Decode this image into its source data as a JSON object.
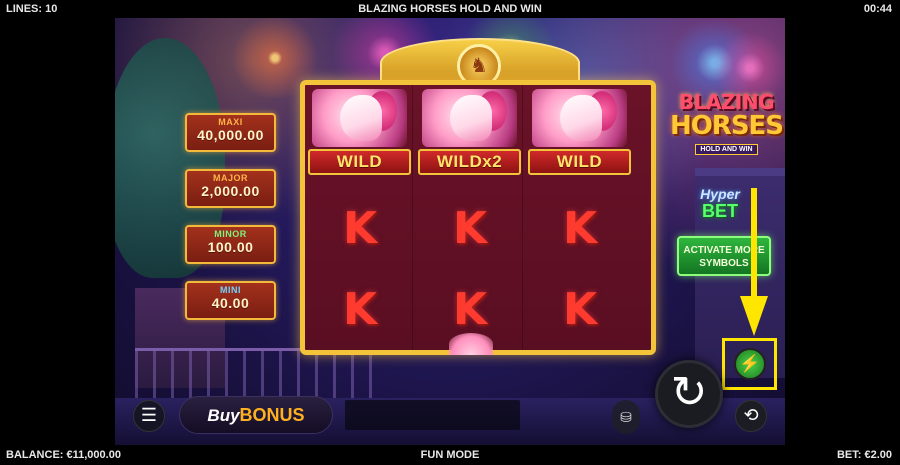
{
  "topbar": {
    "lines": "LINES: 10",
    "title": "BLAZING HORSES HOLD AND WIN",
    "clock": "00:44"
  },
  "bottombar": {
    "balance": "BALANCE: €11,000.00",
    "mode": "FUN MODE",
    "bet": "BET: €2.00"
  },
  "jackpots": [
    {
      "label": "MAXI",
      "value": "40,000.00",
      "color": "#ffb347"
    },
    {
      "label": "MAJOR",
      "value": "2,000.00",
      "color": "#ffb347"
    },
    {
      "label": "MINOR",
      "value": "100.00",
      "color": "#7cf37c"
    },
    {
      "label": "MINI",
      "value": "40.00",
      "color": "#6ed2ff"
    }
  ],
  "reels": [
    {
      "top_symbol": "horse",
      "wild_label": "WILD",
      "rows": [
        "K",
        "K"
      ]
    },
    {
      "top_symbol": "horse",
      "wild_label": "WILDx2",
      "rows": [
        "K",
        "K"
      ]
    },
    {
      "top_symbol": "horse",
      "wild_label": "WILD",
      "rows": [
        "K",
        "K"
      ]
    }
  ],
  "logo": {
    "line1": "BLAZING",
    "line2": "HORSES",
    "line3": "HOLD AND WIN"
  },
  "hyperbet": {
    "hyper": "Hyper",
    "bet": "BET"
  },
  "activate_button": {
    "line1": "ACTIVATE MORE",
    "line2": "SYMBOLS"
  },
  "controls": {
    "menu_icon": "hamburger-icon",
    "buy_label": "Buy",
    "bonus_label": "BONUS",
    "spin_icon": "spin-arrow-icon",
    "coin_icon": "coin-stack-icon",
    "autoplay_icon": "autoplay-icon",
    "lightning_icon": "lightning-icon"
  },
  "colors": {
    "frame_gold": "#f3c43a",
    "highlight_yellow": "#ffe600",
    "wild_text": "#ffe56a",
    "k_red": "#ff3b2f"
  }
}
